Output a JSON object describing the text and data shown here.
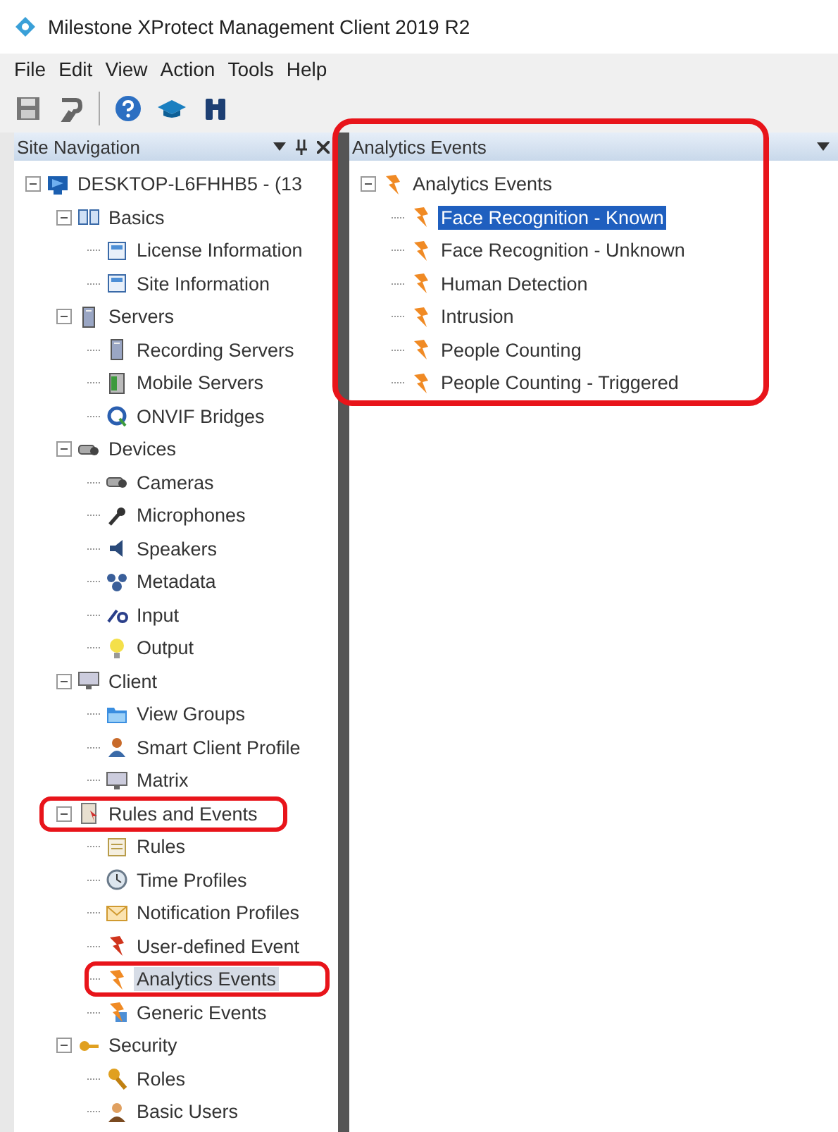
{
  "window": {
    "title": "Milestone XProtect Management Client 2019 R2"
  },
  "menu": [
    "File",
    "Edit",
    "View",
    "Action",
    "Tools",
    "Help"
  ],
  "site_navigation": {
    "title": "Site Navigation",
    "tree": [
      {
        "label": "DESKTOP-L6FHHB5 - (13",
        "expanded": true,
        "selected": false,
        "children": [
          {
            "label": "Basics",
            "expanded": true,
            "selected": false,
            "children": [
              {
                "label": "License Information",
                "selected": false
              },
              {
                "label": "Site Information",
                "selected": false
              }
            ]
          },
          {
            "label": "Servers",
            "expanded": true,
            "selected": false,
            "children": [
              {
                "label": "Recording Servers",
                "selected": false
              },
              {
                "label": "Mobile Servers",
                "selected": false
              },
              {
                "label": "ONVIF Bridges",
                "selected": false
              }
            ]
          },
          {
            "label": "Devices",
            "expanded": true,
            "selected": false,
            "children": [
              {
                "label": "Cameras",
                "selected": false
              },
              {
                "label": "Microphones",
                "selected": false
              },
              {
                "label": "Speakers",
                "selected": false
              },
              {
                "label": "Metadata",
                "selected": false
              },
              {
                "label": "Input",
                "selected": false
              },
              {
                "label": "Output",
                "selected": false
              }
            ]
          },
          {
            "label": "Client",
            "expanded": true,
            "selected": false,
            "children": [
              {
                "label": "View Groups",
                "selected": false
              },
              {
                "label": "Smart Client Profile",
                "selected": false
              },
              {
                "label": "Matrix",
                "selected": false
              }
            ]
          },
          {
            "label": "Rules and Events",
            "expanded": true,
            "selected": false,
            "children": [
              {
                "label": "Rules",
                "selected": false
              },
              {
                "label": "Time Profiles",
                "selected": false
              },
              {
                "label": "Notification Profiles",
                "selected": false
              },
              {
                "label": "User-defined Event",
                "selected": false
              },
              {
                "label": "Analytics Events",
                "selected": true
              },
              {
                "label": "Generic Events",
                "selected": false
              }
            ]
          },
          {
            "label": "Security",
            "expanded": true,
            "selected": false,
            "children": [
              {
                "label": "Roles",
                "selected": false
              },
              {
                "label": "Basic Users",
                "selected": false
              }
            ]
          }
        ]
      }
    ]
  },
  "analytics_events": {
    "title": "Analytics Events",
    "tree": [
      {
        "label": "Analytics Events",
        "expanded": true,
        "selected": false,
        "children": [
          {
            "label": "Face Recognition - Known",
            "selected": true
          },
          {
            "label": "Face Recognition - Unknown",
            "selected": false
          },
          {
            "label": "Human Detection",
            "selected": false
          },
          {
            "label": "Intrusion",
            "selected": false
          },
          {
            "label": "People Counting",
            "selected": false
          },
          {
            "label": "People Counting - Triggered",
            "selected": false
          }
        ]
      }
    ]
  }
}
